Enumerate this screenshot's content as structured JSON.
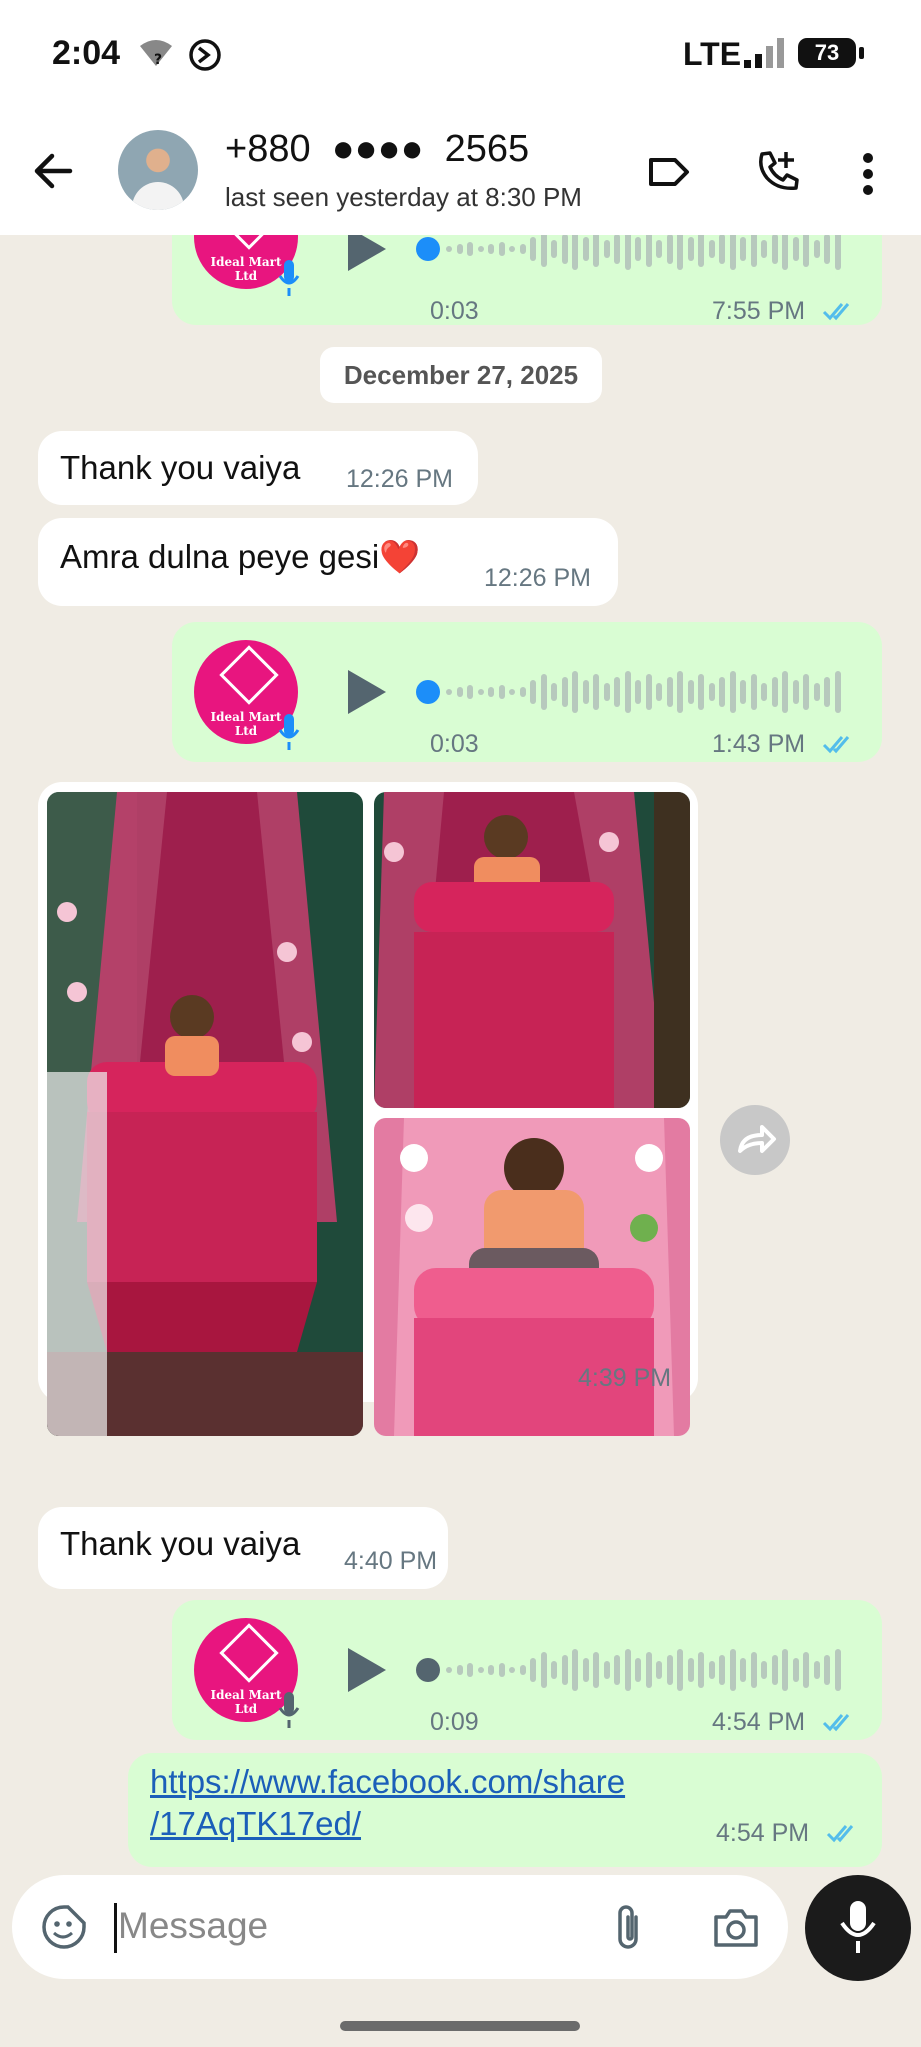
{
  "status_bar": {
    "time": "2:04",
    "network": "LTE",
    "battery": "73"
  },
  "header": {
    "contact_name": "+880  ●●●●  2565",
    "last_seen": "last seen yesterday at 8:30 PM"
  },
  "chat": {
    "date_separator": "December 27, 2025",
    "messages": [
      {
        "type": "voice",
        "direction": "outgoing",
        "duration": "0:03",
        "time": "7:55 PM",
        "read": true
      },
      {
        "type": "text",
        "direction": "incoming",
        "text": "Thank you vaiya",
        "time": "12:26 PM"
      },
      {
        "type": "text",
        "direction": "incoming",
        "text": "Amra dulna peye gesi❤️",
        "time": "12:26 PM"
      },
      {
        "type": "voice",
        "direction": "outgoing",
        "duration": "0:03",
        "time": "1:43 PM",
        "read": true
      },
      {
        "type": "photos",
        "direction": "incoming",
        "count": 3,
        "time": "4:39 PM"
      },
      {
        "type": "text",
        "direction": "incoming",
        "text": "Thank you vaiya",
        "time": "4:40 PM"
      },
      {
        "type": "voice",
        "direction": "outgoing",
        "duration": "0:09",
        "time": "4:54 PM",
        "read": true
      },
      {
        "type": "link",
        "direction": "outgoing",
        "line1": "https://www.facebook.com/share",
        "line2": "/17AqTK17ed/",
        "time": "4:54 PM",
        "read": true
      }
    ],
    "voice_avatar_text": "Ideal Mart Ltd"
  },
  "composer": {
    "placeholder": "Message"
  },
  "colors": {
    "outgoing_bubble": "#d9fdd3",
    "incoming_bubble": "#ffffff",
    "read_ticks": "#53bdeb",
    "link": "#1b5fb9",
    "voice_dot": "#1c8ef9"
  },
  "icons": [
    "back-arrow-icon",
    "label-icon",
    "add-call-icon",
    "more-vert-icon",
    "sticker-icon",
    "attach-icon",
    "camera-icon",
    "mic-icon",
    "forward-icon"
  ]
}
